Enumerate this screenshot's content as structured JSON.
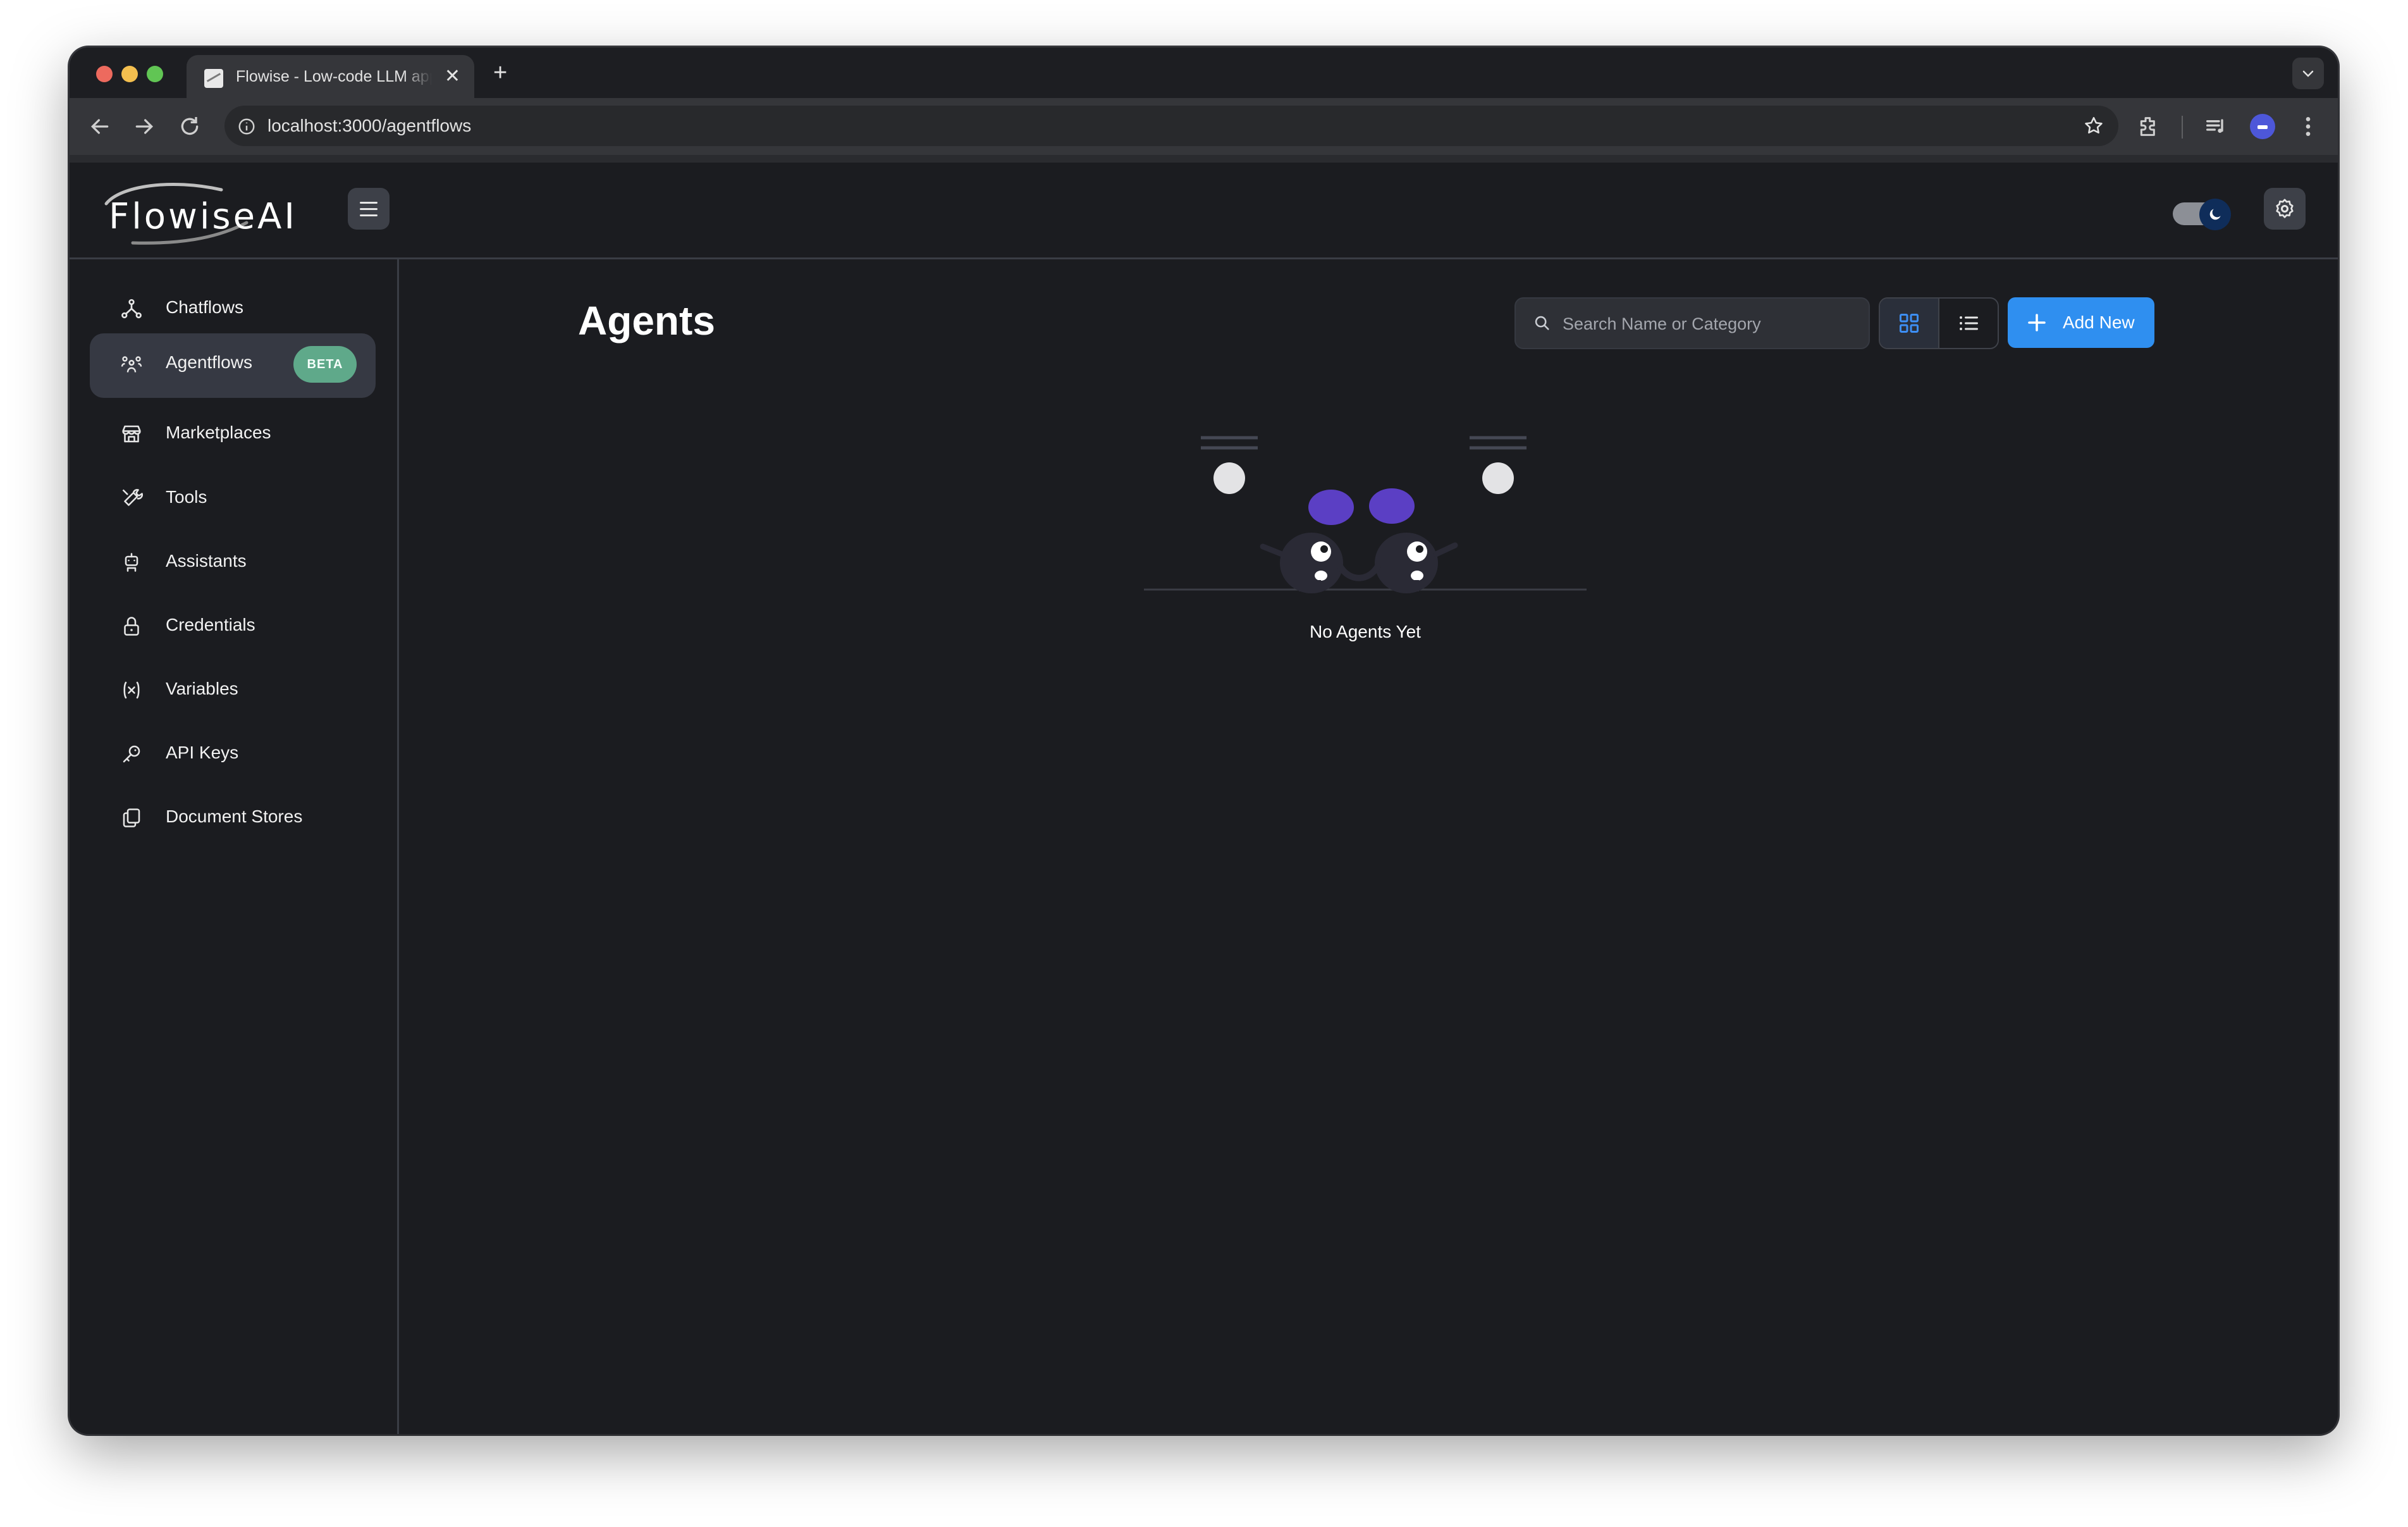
{
  "browser": {
    "tab_title": "Flowise - Low-code LLM apps",
    "close_glyph": "✕",
    "new_tab_glyph": "+",
    "url": "localhost:3000/agentflows"
  },
  "app": {
    "logo_text": "FlowiseAI",
    "sidebar": {
      "items": [
        {
          "label": "Chatflows",
          "icon": "chatflows-icon"
        },
        {
          "label": "Agentflows",
          "icon": "agentflows-icon",
          "badge": "BETA",
          "active": true
        },
        {
          "label": "Marketplaces",
          "icon": "marketplace-icon"
        },
        {
          "label": "Tools",
          "icon": "tools-icon"
        },
        {
          "label": "Assistants",
          "icon": "assistants-icon"
        },
        {
          "label": "Credentials",
          "icon": "lock-icon"
        },
        {
          "label": "Variables",
          "icon": "variables-icon"
        },
        {
          "label": "API Keys",
          "icon": "key-icon"
        },
        {
          "label": "Document Stores",
          "icon": "document-stores-icon"
        }
      ]
    },
    "main": {
      "title": "Agents",
      "search_placeholder": "Search Name or Category",
      "add_button": "Add New",
      "empty_text": "No Agents Yet",
      "view_mode": "grid"
    }
  },
  "colors": {
    "background": "#1b1c20",
    "accent": "#2f8ff0",
    "beta_badge": "#5fa98a",
    "illustration_purple": "#5b3fc4"
  }
}
